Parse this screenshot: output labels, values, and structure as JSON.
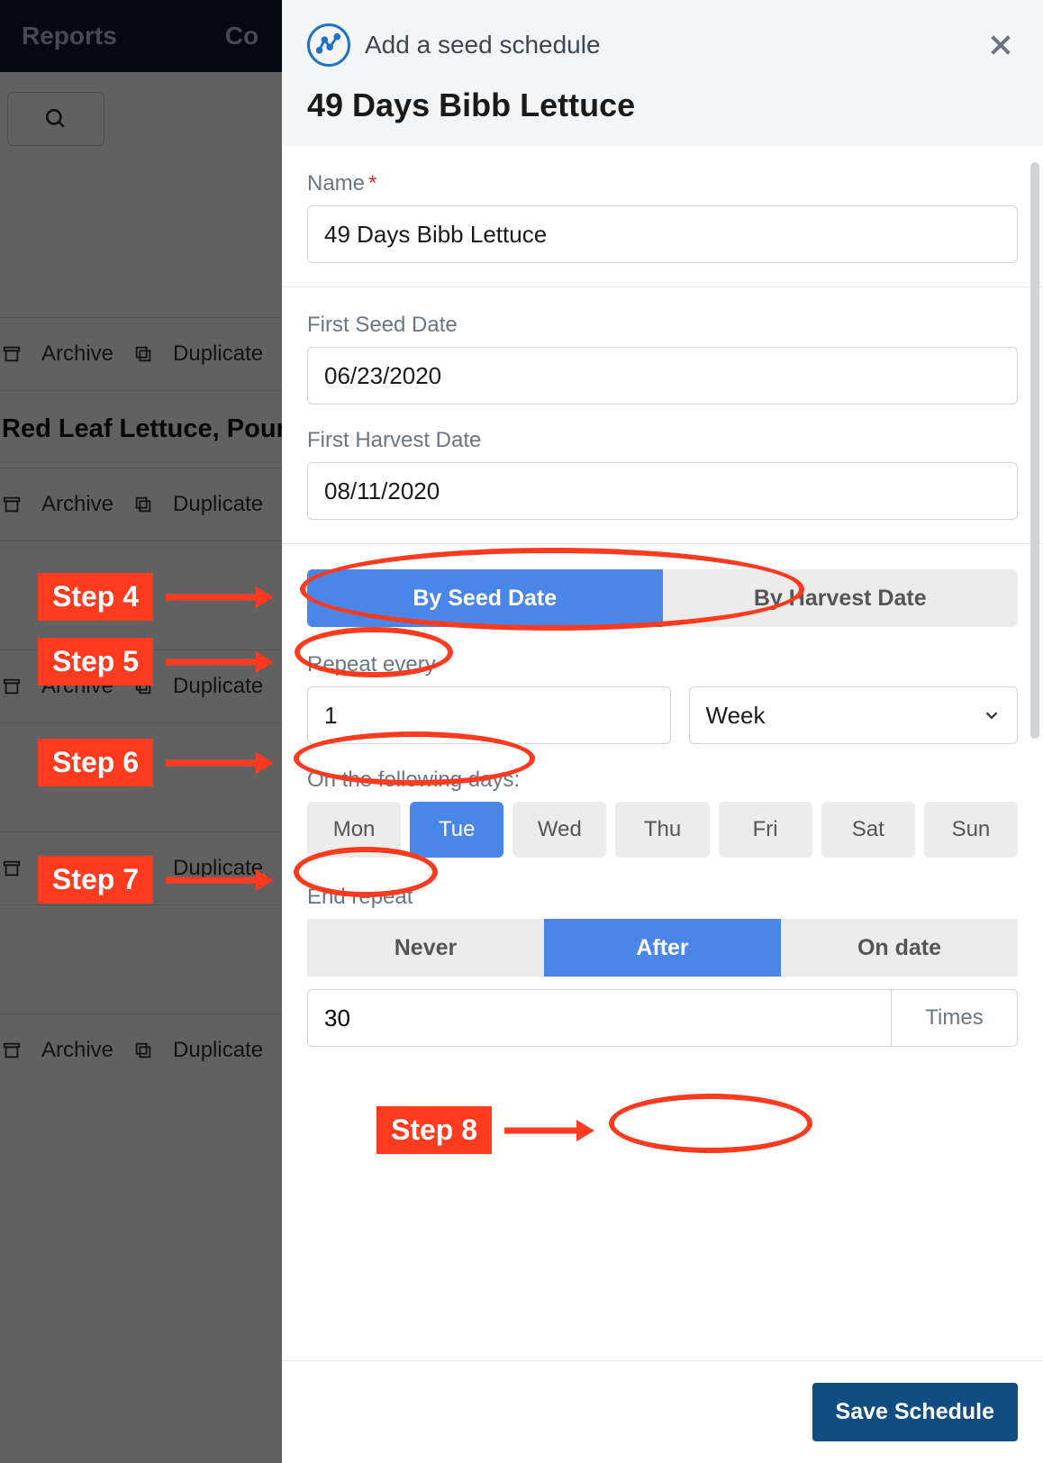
{
  "bg": {
    "tabs": [
      "Reports",
      "Co"
    ],
    "archive": "Archive",
    "duplicate": "Duplicate",
    "section_title": "Red Leaf Lettuce, Pound o"
  },
  "drawer": {
    "title": "Add a seed schedule",
    "subtitle": "49 Days Bibb Lettuce",
    "name_label": "Name",
    "name_value": "49 Days Bibb Lettuce",
    "first_seed_label": "First Seed Date",
    "first_seed_value": "06/23/2020",
    "first_harvest_label": "First Harvest Date",
    "first_harvest_value": "08/11/2020",
    "by_seed": "By Seed Date",
    "by_harvest": "By Harvest Date",
    "repeat_label": "Repeat every",
    "repeat_n": "1",
    "repeat_unit": "Week",
    "days_label": "On the following days:",
    "days": [
      "Mon",
      "Tue",
      "Wed",
      "Thu",
      "Fri",
      "Sat",
      "Sun"
    ],
    "days_active": "Tue",
    "end_label": "End repeat",
    "end_opts": [
      "Never",
      "After",
      "On date"
    ],
    "end_active": "After",
    "times_n": "30",
    "times_label": "Times",
    "save": "Save Schedule"
  },
  "steps": {
    "s4": "Step 4",
    "s5": "Step 5",
    "s6": "Step 6",
    "s7": "Step 7",
    "s8": "Step 8"
  }
}
